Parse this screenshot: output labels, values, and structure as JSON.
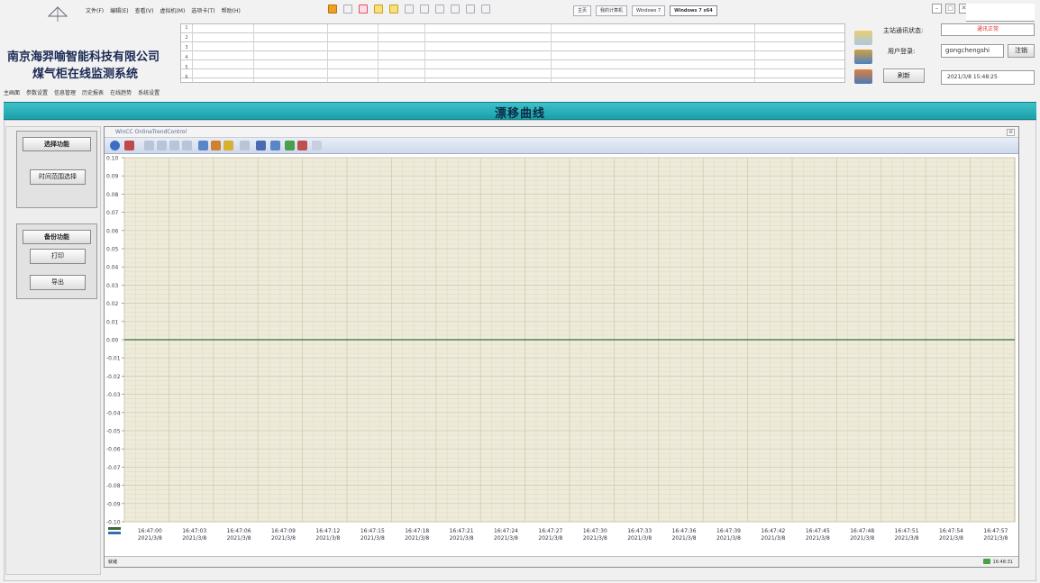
{
  "menubar": {
    "items": [
      "文件(F)",
      "编辑(E)",
      "查看(V)",
      "虚拟机(M)",
      "选项卡(T)",
      "帮助(H)"
    ]
  },
  "window_tabs": [
    "主页",
    "我的计算机",
    "Windows 7",
    "Windows 7 x64"
  ],
  "header": {
    "company": "南京海羿喻智能科技有限公司",
    "system": "煤气柜在线监测系统"
  },
  "alarm_rows": [
    "1",
    "2",
    "3",
    "4",
    "5",
    "6"
  ],
  "status_panel": {
    "comm_label": "主站通讯状态:",
    "comm_value": "通讯正常",
    "user_label": "用户登录:",
    "user_value": "gongchengshi",
    "logout_button": "注销",
    "refresh_button": "刷新",
    "datetime": "2021/3/8 15:48:25"
  },
  "nav": {
    "items": [
      "主画面",
      "参数设置",
      "信息管理",
      "历史报表",
      "在线趋势",
      "系统设置"
    ]
  },
  "banner_title": "漂移曲线",
  "left_panel": {
    "select_header": "选择功能",
    "time_range_button": "时间范围选择",
    "backup_header": "备份功能",
    "print_button": "打印",
    "export_button": "导出"
  },
  "trend": {
    "title": "WinCC OnlineTrendControl",
    "status_left": "就绪",
    "status_right": "16:48:31"
  },
  "chart_data": {
    "type": "line",
    "y_ticks": [
      "0.10",
      "0.09",
      "0.08",
      "0.07",
      "0.06",
      "0.05",
      "0.04",
      "0.03",
      "0.02",
      "0.01",
      "0.00",
      "-0.01",
      "-0.02",
      "-0.03",
      "-0.04",
      "-0.05",
      "-0.06",
      "-0.07",
      "-0.08",
      "-0.09",
      "-0.10"
    ],
    "ylim": [
      -0.1,
      0.1
    ],
    "x_times": [
      "16:47:00",
      "16:47:03",
      "16:47:06",
      "16:47:09",
      "16:47:12",
      "16:47:15",
      "16:47:18",
      "16:47:21",
      "16:47:24",
      "16:47:27",
      "16:47:30",
      "16:47:33",
      "16:47:36",
      "16:47:39",
      "16:47:42",
      "16:47:45",
      "16:47:48",
      "16:47:51",
      "16:47:54",
      "16:47:57"
    ],
    "x_dates": [
      "2021/3/8",
      "2021/3/8",
      "2021/3/8",
      "2021/3/8",
      "2021/3/8",
      "2021/3/8",
      "2021/3/8",
      "2021/3/8",
      "2021/3/8",
      "2021/3/8",
      "2021/3/8",
      "2021/3/8",
      "2021/3/8",
      "2021/3/8",
      "2021/3/8",
      "2021/3/8",
      "2021/3/8",
      "2021/3/8",
      "2021/3/8",
      "2021/3/8"
    ],
    "series": [
      {
        "values": [
          0,
          0,
          0,
          0,
          0,
          0,
          0,
          0,
          0,
          0,
          0,
          0,
          0,
          0,
          0,
          0,
          0,
          0,
          0,
          0
        ],
        "color": "#2f6b3a"
      }
    ],
    "grid": true,
    "plot_background": "#efebda"
  },
  "colors": {
    "banner": "#27b1ba",
    "title_text": "#1b2a55",
    "status_ok": "#e03030"
  }
}
